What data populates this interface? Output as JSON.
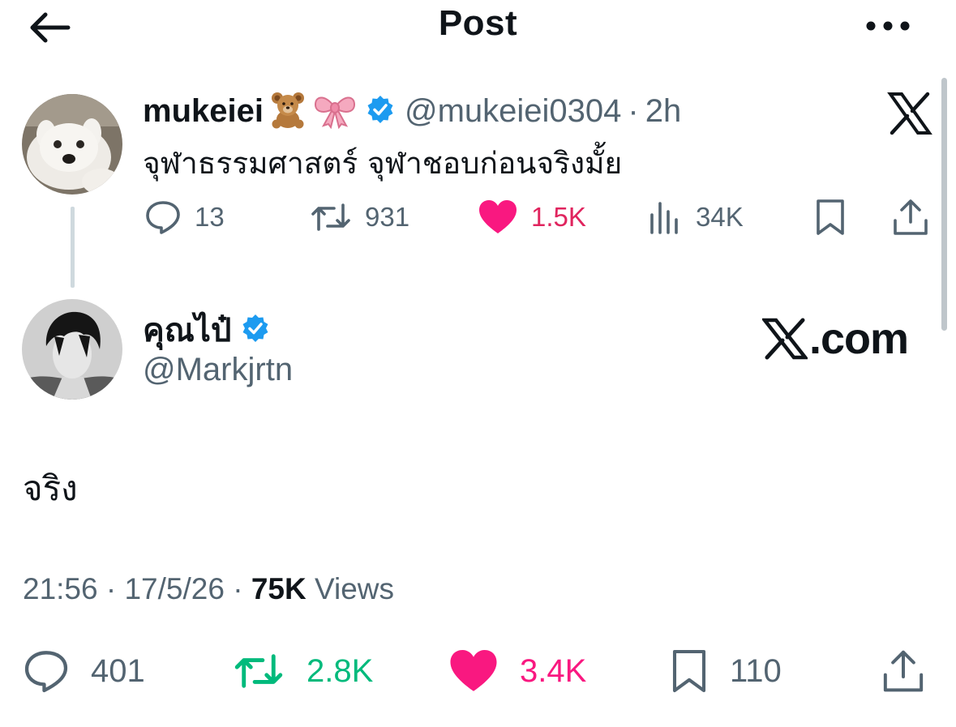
{
  "header": {
    "title": "Post",
    "back_icon": "arrow-left-icon",
    "more_icon": "more-horizontal-icon"
  },
  "quoted_post": {
    "display_name": "mukeiei",
    "name_emojis": [
      "teddy-bear-emoji",
      "ribbon-emoji"
    ],
    "verified_icon": "verified-badge-icon",
    "handle": "@mukeiei0304",
    "separator": "·",
    "time": "2h",
    "text": "จุฬาธรรมศาสตร์ จุฬาชอบก่อนจริงมั้ย",
    "source_logo": "x-logo-icon",
    "stats": {
      "replies": "13",
      "reposts": "931",
      "likes": "1.5K",
      "views": "34K"
    }
  },
  "post": {
    "display_name": "คุณไป๋",
    "verified_icon": "verified-badge-icon",
    "handle": "@Markjrtn",
    "watermark": ".com",
    "text": "จริง",
    "time": "21:56",
    "date": "17/5/26",
    "separator": "·",
    "views_count": "75K",
    "views_label": "Views",
    "stats": {
      "replies": "401",
      "reposts": "2.8K",
      "likes": "3.4K",
      "bookmarks": "110"
    }
  },
  "colors": {
    "text_primary": "#0f1419",
    "text_secondary": "#536471",
    "like_pink": "#f91880",
    "repost_green": "#00ba7c",
    "verified_blue": "#1d9bf0",
    "thread_line": "#cfd9de"
  }
}
